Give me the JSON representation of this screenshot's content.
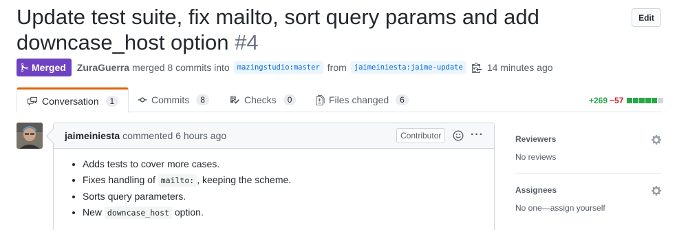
{
  "pr": {
    "title": "Update test suite, fix mailto, sort query params and add downcase_host option",
    "number": "#4",
    "edit_label": "Edit",
    "status": "Merged",
    "merged_by": "ZuraGuerra",
    "merged_text": "merged 8 commits into",
    "base_branch": "mazingstudio:master",
    "from_text": "from",
    "head_branch": "jaimeiniesta:jaime-update",
    "time": "14 minutes ago"
  },
  "tabs": [
    {
      "label": "Conversation",
      "count": "1",
      "icon": "comment-discussion-icon"
    },
    {
      "label": "Commits",
      "count": "8",
      "icon": "commit-icon"
    },
    {
      "label": "Checks",
      "count": "0",
      "icon": "checklist-icon"
    },
    {
      "label": "Files changed",
      "count": "6",
      "icon": "file-diff-icon"
    }
  ],
  "diffstat": {
    "additions": "+269",
    "deletions": "−57",
    "blocks": [
      "#28a745",
      "#28a745",
      "#28a745",
      "#28a745",
      "#28a745",
      "#d1d5da"
    ]
  },
  "comment": {
    "author": "jaimeiniesta",
    "action": "commented 6 hours ago",
    "role": "Contributor",
    "more": "···",
    "items": [
      {
        "text": "Adds tests to cover more cases."
      },
      {
        "pre": "Fixes handling of",
        "code": "mailto:",
        "post": ", keeping the scheme."
      },
      {
        "text": "Sorts query parameters."
      },
      {
        "pre": "New",
        "code": "downcase_host",
        "post": "option."
      }
    ]
  },
  "sidebar": {
    "reviewers": {
      "title": "Reviewers",
      "value": "No reviews"
    },
    "assignees": {
      "title": "Assignees",
      "value": "No one—assign yourself"
    }
  },
  "colors": {
    "merged": "#6f42c1",
    "tab_accent": "#e36209",
    "link": "#0366d6",
    "addition": "#28a745",
    "deletion": "#cb2431"
  }
}
